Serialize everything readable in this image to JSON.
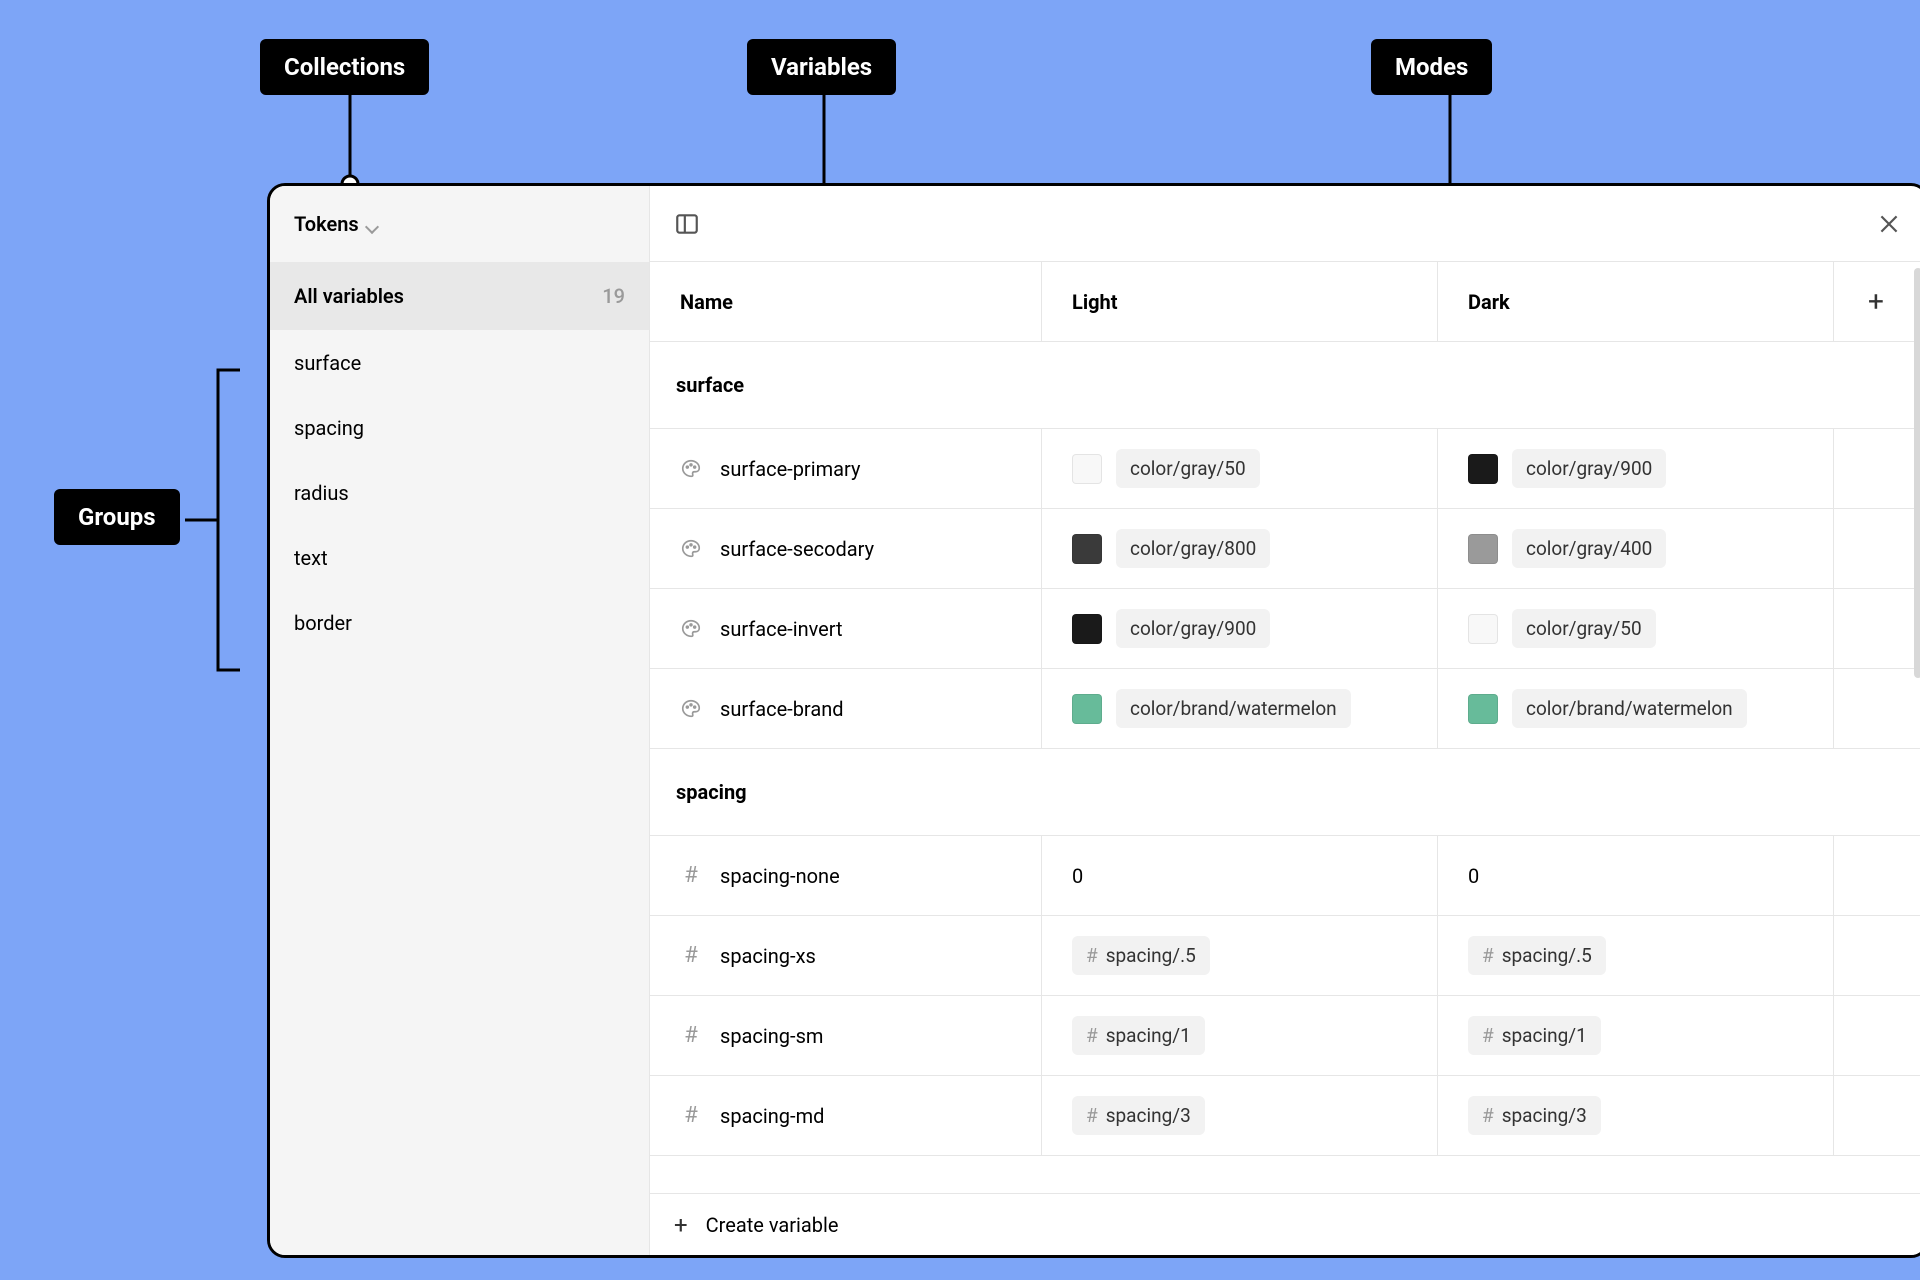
{
  "annotations": {
    "collections": "Collections",
    "variables": "Variables",
    "modes": "Modes",
    "groups": "Groups"
  },
  "sidebar": {
    "collection_label": "Tokens",
    "all_variables_label": "All variables",
    "variable_count": "19",
    "groups": [
      {
        "label": "surface"
      },
      {
        "label": "spacing"
      },
      {
        "label": "radius"
      },
      {
        "label": "text"
      },
      {
        "label": "border"
      }
    ]
  },
  "header": {
    "name_label": "Name",
    "modes": [
      "Light",
      "Dark"
    ]
  },
  "table": {
    "groups": [
      {
        "name": "surface",
        "rows": [
          {
            "type": "color",
            "label": "surface-primary",
            "light": {
              "swatch": "#f8f8f8",
              "alias": "color/gray/50"
            },
            "dark": {
              "swatch": "#1a1a1a",
              "alias": "color/gray/900"
            }
          },
          {
            "type": "color",
            "label": "surface-secodary",
            "light": {
              "swatch": "#3a3a3a",
              "alias": "color/gray/800"
            },
            "dark": {
              "swatch": "#9a9a9a",
              "alias": "color/gray/400"
            }
          },
          {
            "type": "color",
            "label": "surface-invert",
            "light": {
              "swatch": "#1a1a1a",
              "alias": "color/gray/900"
            },
            "dark": {
              "swatch": "#f8f8f8",
              "alias": "color/gray/50"
            }
          },
          {
            "type": "color",
            "label": "surface-brand",
            "light": {
              "swatch": "#67bb9a",
              "alias": "color/brand/watermelon"
            },
            "dark": {
              "swatch": "#67bb9a",
              "alias": "color/brand/watermelon"
            }
          }
        ]
      },
      {
        "name": "spacing",
        "rows": [
          {
            "type": "number",
            "label": "spacing-none",
            "light": {
              "raw": "0"
            },
            "dark": {
              "raw": "0"
            }
          },
          {
            "type": "number",
            "label": "spacing-xs",
            "light": {
              "num_alias": "spacing/.5"
            },
            "dark": {
              "num_alias": "spacing/.5"
            }
          },
          {
            "type": "number",
            "label": "spacing-sm",
            "light": {
              "num_alias": "spacing/1"
            },
            "dark": {
              "num_alias": "spacing/1"
            }
          },
          {
            "type": "number",
            "label": "spacing-md",
            "light": {
              "num_alias": "spacing/3"
            },
            "dark": {
              "num_alias": "spacing/3"
            }
          }
        ]
      }
    ]
  },
  "footer": {
    "create_label": "Create variable"
  }
}
